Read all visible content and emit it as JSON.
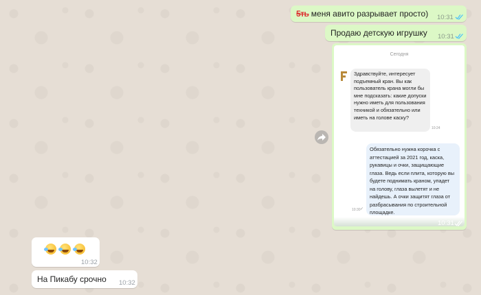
{
  "messages": {
    "m1": {
      "strike": "5ть",
      "text": "меня авито разрывает просто)",
      "time": "10:31"
    },
    "m2": {
      "text": "Продаю детскую игрушку",
      "time": "10:31"
    },
    "m3": {
      "time": "10:31"
    },
    "m4": {
      "time": "10:32"
    },
    "m5": {
      "text": "На Пикабу срочно",
      "time": "10:32"
    }
  },
  "screenshot": {
    "date_separator": "Сегодня",
    "question": "Здравствуйте, интересует подъемный кран. Вы как пользователь крана могли бы мне подсказать: какие допуски нужно иметь для пользования техникой и обязательно или иметь на голове каску?",
    "question_time": "10:24",
    "answer": "Обязательно нужна корочка с аттестацией за 2021 год, каска, рукавицы и очки, защищающие глаза. Ведь если плита, которую вы будете поднимать краном, упадет на голову, глаза вылетят и не найдешь. А очки защитят глаза от разбрасывания по строительной площадке.",
    "answer_time": "10:30"
  },
  "emoji": [
    "rofl-emoji",
    "rofl-emoji",
    "rofl-emoji"
  ],
  "colors": {
    "outgoing": "#dcf8c6",
    "incoming": "#ffffff",
    "read_ticks": "#4fc3f7"
  }
}
